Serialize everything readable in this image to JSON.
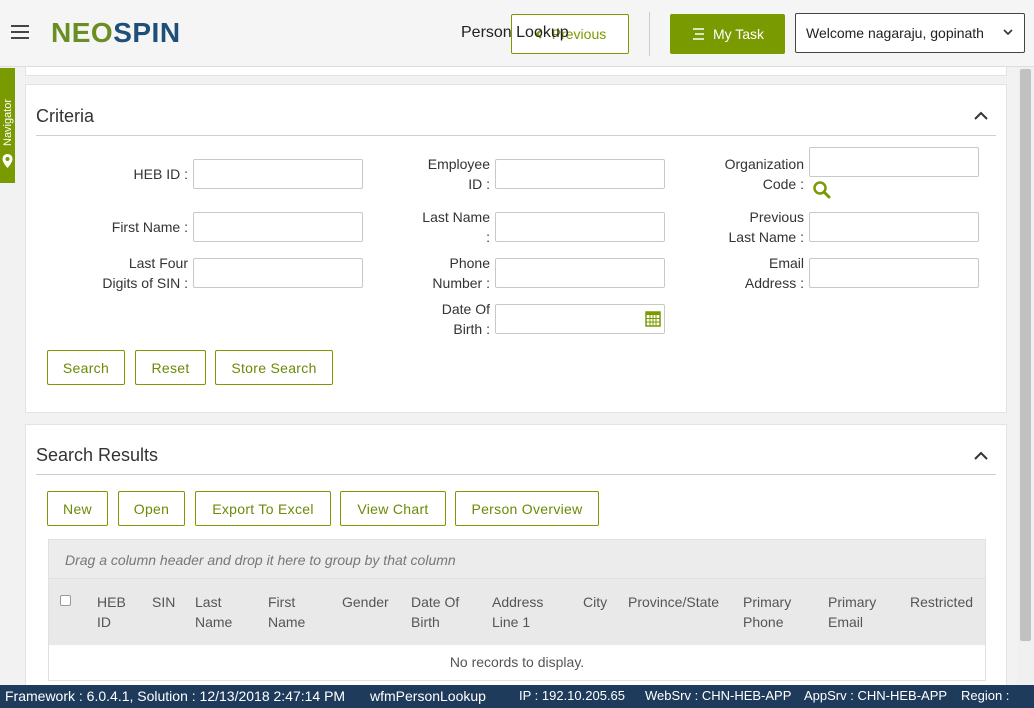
{
  "header": {
    "logo_part1": "NEO",
    "logo_part2": "SPIN",
    "page_title": "Person Lookup",
    "previous_label": "Previous",
    "mytask_label": "My Task",
    "welcome_text": "Welcome nagaraju, gopinath"
  },
  "navigator": {
    "label": "Navigator"
  },
  "criteria": {
    "title": "Criteria",
    "fields": {
      "heb_id": {
        "label": "HEB ID :",
        "value": ""
      },
      "employee_id": {
        "label_line1": "Employee",
        "label_line2": "ID :",
        "value": ""
      },
      "organization_code": {
        "label_line1": "Organization",
        "label_line2": "Code :",
        "value": ""
      },
      "first_name": {
        "label": "First Name :",
        "value": ""
      },
      "last_name": {
        "label_line1": "Last Name",
        "label_line2": ":",
        "value": ""
      },
      "previous_last_name": {
        "label_line1": "Previous",
        "label_line2": "Last Name :",
        "value": ""
      },
      "last_four_sin": {
        "label_line1": "Last Four",
        "label_line2": "Digits of SIN :",
        "value": ""
      },
      "phone_number": {
        "label_line1": "Phone",
        "label_line2": "Number :",
        "value": ""
      },
      "email_address": {
        "label_line1": "Email",
        "label_line2": "Address :",
        "value": ""
      },
      "date_of_birth": {
        "label_line1": "Date Of",
        "label_line2": "Birth :",
        "value": ""
      }
    },
    "buttons": {
      "search": "Search",
      "reset": "Reset",
      "store_search": "Store Search"
    }
  },
  "results": {
    "title": "Search Results",
    "buttons": {
      "new": "New",
      "open": "Open",
      "export": "Export To Excel",
      "view_chart": "View Chart",
      "person_overview": "Person Overview"
    },
    "group_hint": "Drag a column header and drop it here to group by that column",
    "columns": {
      "heb_id_1": "HEB",
      "heb_id_2": "ID",
      "sin": "SIN",
      "last_name_1": "Last",
      "last_name_2": "Name",
      "first_name_1": "First",
      "first_name_2": "Name",
      "gender": "Gender",
      "dob_1": "Date Of",
      "dob_2": "Birth",
      "address_1": "Address",
      "address_2": "Line 1",
      "city": "City",
      "province": "Province/State",
      "phone_1": "Primary",
      "phone_2": "Phone",
      "email_1": "Primary",
      "email_2": "Email",
      "restricted": "Restricted"
    },
    "empty_text": "No records to display."
  },
  "footer": {
    "framework": "Framework : 6.0.4.1, Solution : 12/13/2018 2:47:14 PM",
    "form": "wfmPersonLookup",
    "ip": "IP : 192.10.205.65",
    "websrv": "WebSrv : CHN-HEB-APP",
    "appsrv": "AppSrv : CHN-HEB-APP",
    "region": "Region :"
  },
  "colors": {
    "accent": "#7a9a01",
    "brand_dark": "#1f4e79",
    "footer_bg": "#1f3b5c"
  }
}
